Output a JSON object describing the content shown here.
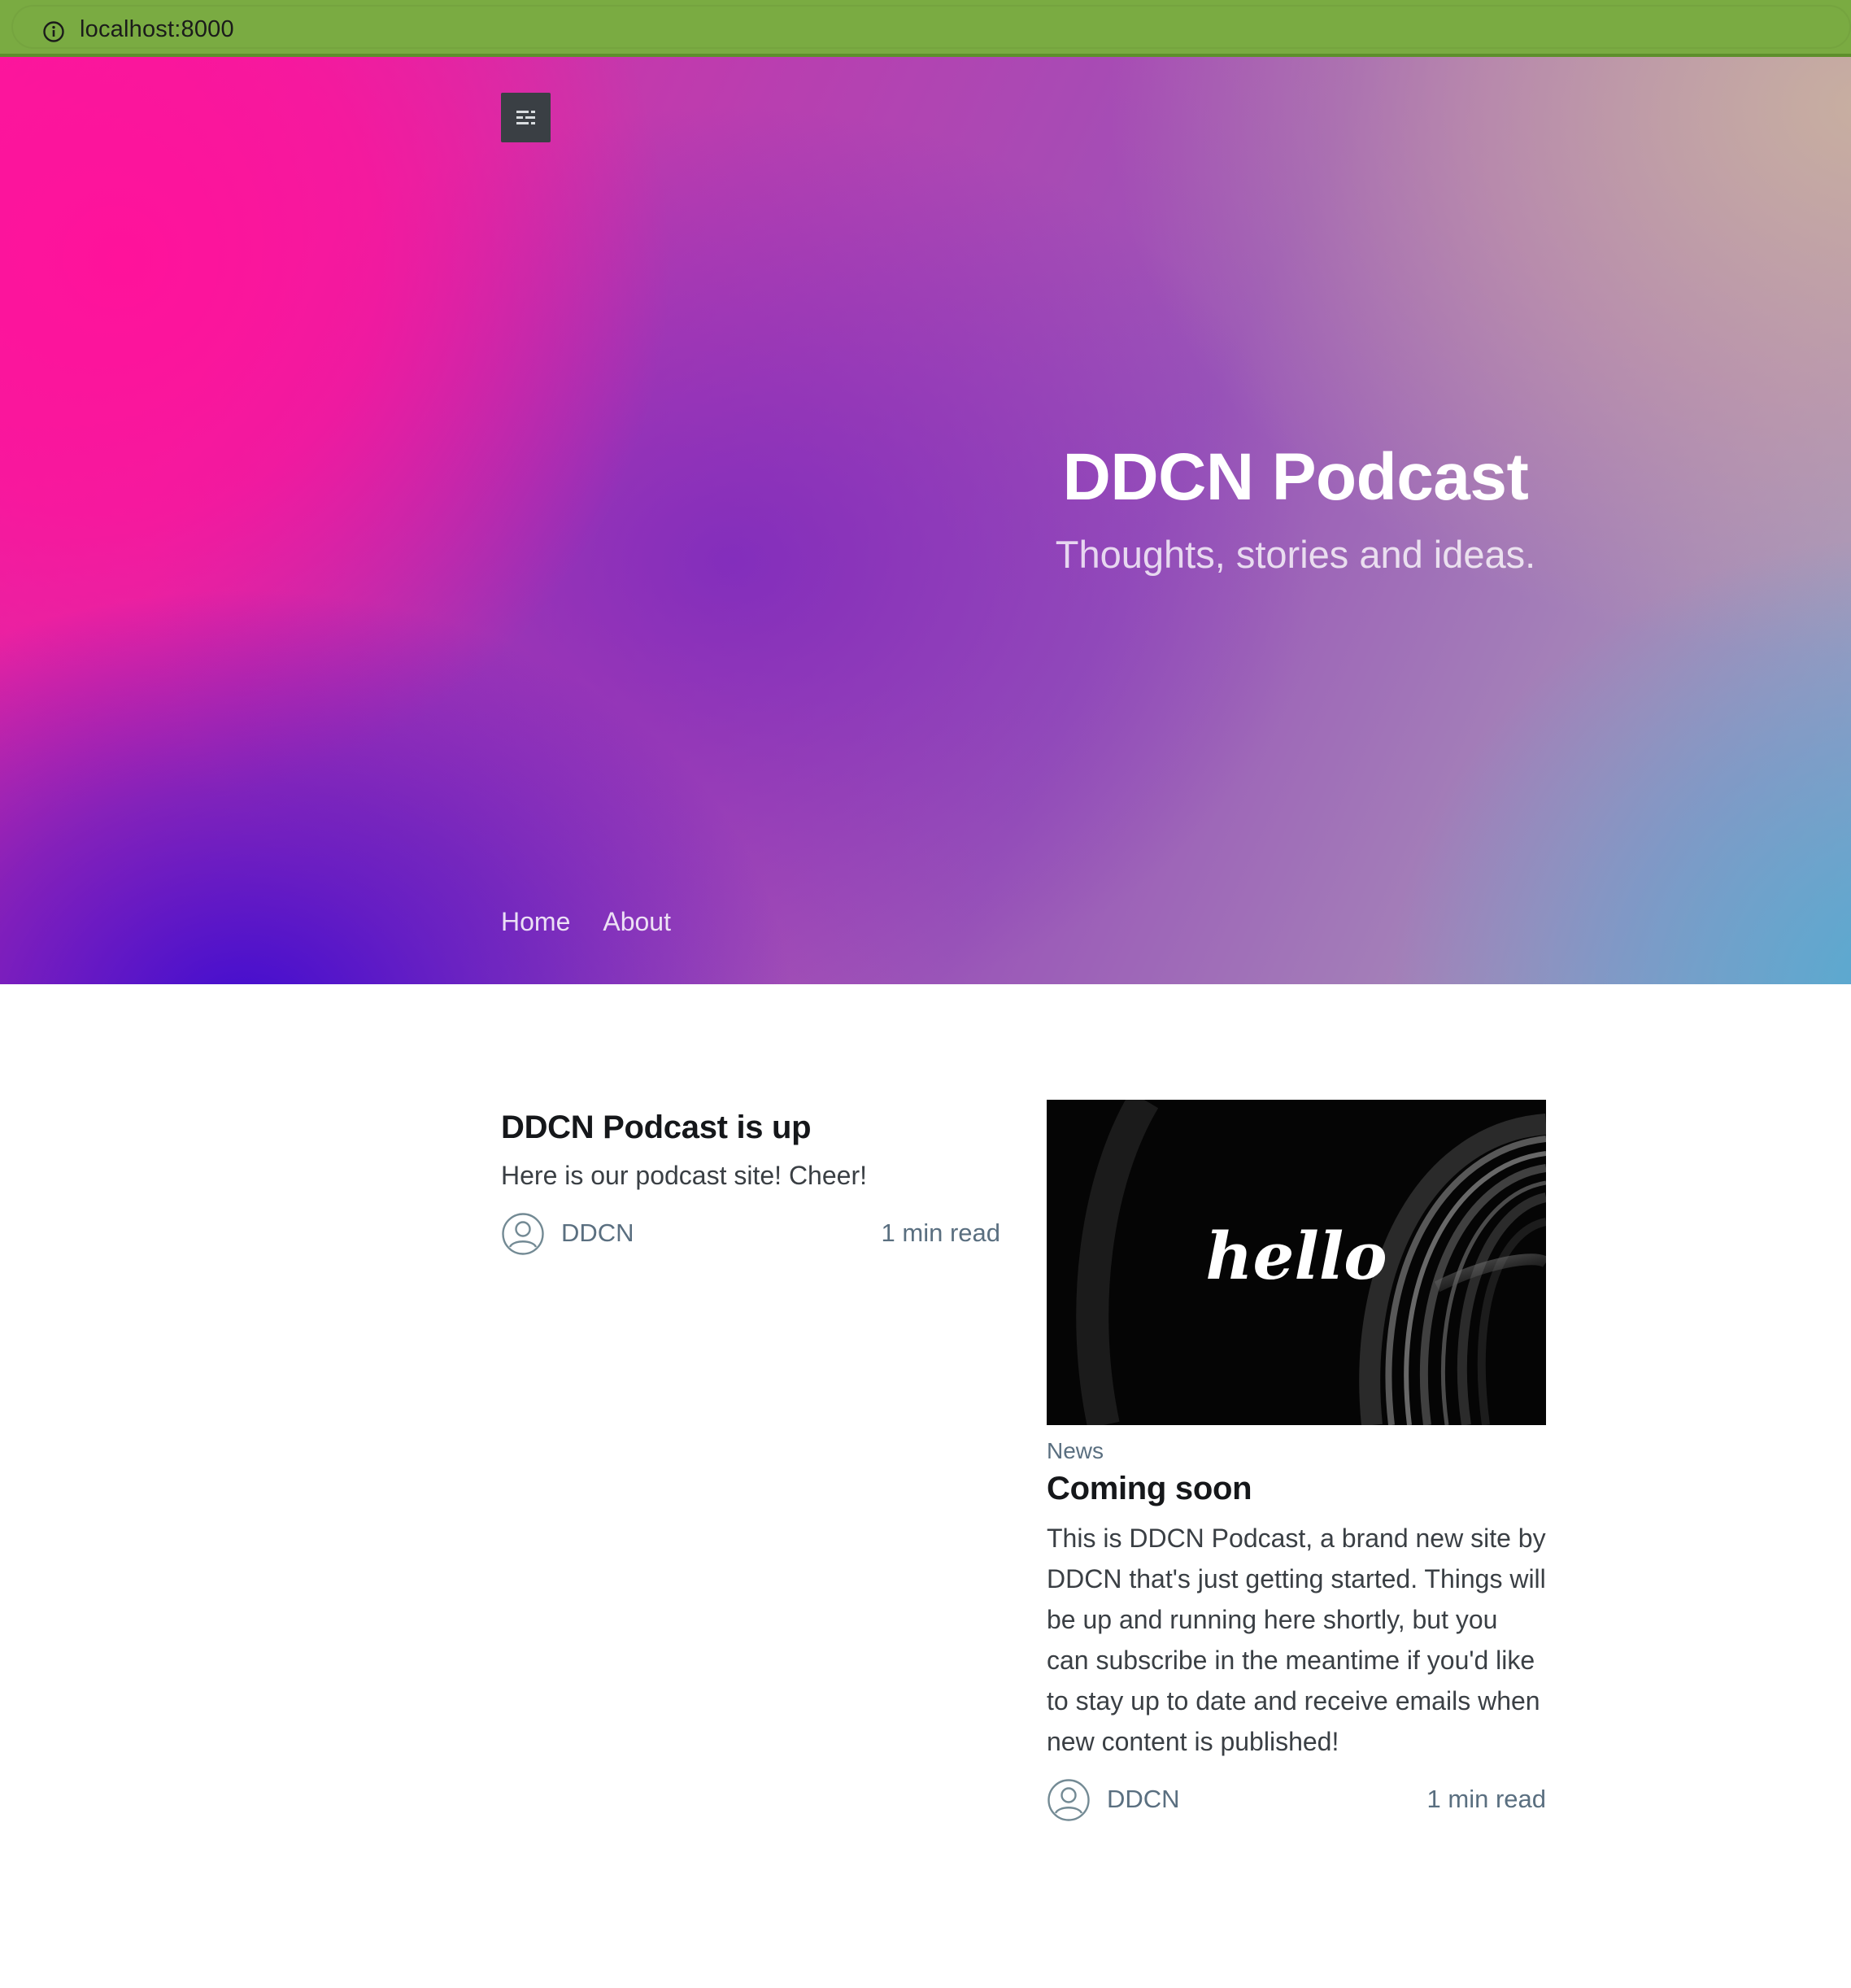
{
  "browser": {
    "url": "localhost:8000",
    "address_bar_color": "#7aab42"
  },
  "header": {
    "menu_icon": "menu-icon",
    "title": "DDCN Podcast",
    "tagline": "Thoughts, stories and ideas.",
    "nav": [
      {
        "label": "Home"
      },
      {
        "label": "About"
      }
    ]
  },
  "posts": [
    {
      "title": "DDCN Podcast is up",
      "excerpt": "Here is our podcast site! Cheer!",
      "author": "DDCN",
      "read_time": "1 min read",
      "avatar_icon": "user-avatar-icon"
    },
    {
      "image_text": "hello",
      "tag": "News",
      "title": "Coming soon",
      "excerpt": "This is DDCN Podcast, a brand new site by DDCN that's just getting started. Things will be up and running here shortly, but you can subscribe in the meantime if you'd like to stay up to date and receive emails when new content is published!",
      "author": "DDCN",
      "read_time": "1 min read",
      "avatar_icon": "user-avatar-icon"
    }
  ],
  "colors": {
    "text_dark": "#15171a",
    "text_body": "#3a3f44",
    "text_meta": "#5a6f80",
    "menu_button_bg": "#3a3f44"
  }
}
